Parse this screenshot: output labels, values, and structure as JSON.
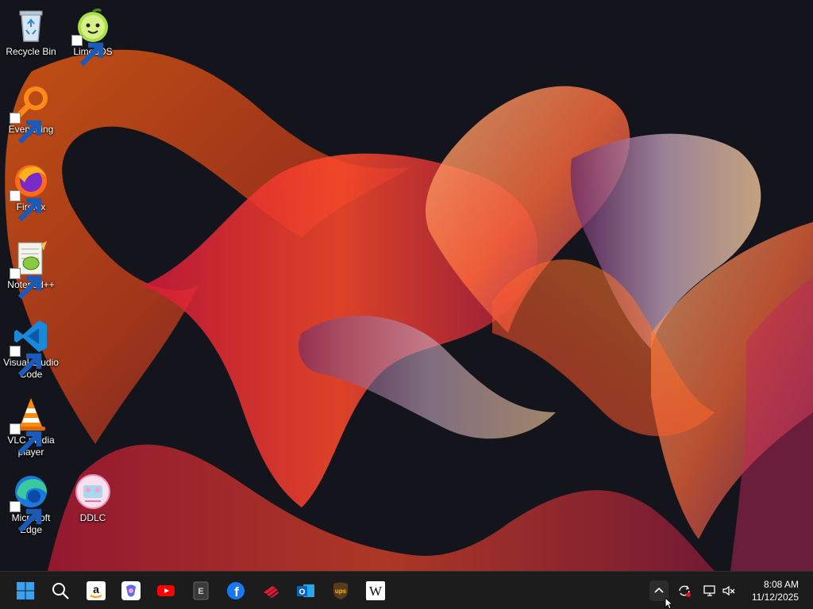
{
  "desktop": {
    "icons": [
      {
        "label": "Recycle Bin",
        "icon": "recycle-bin-icon"
      },
      {
        "label": "Lime3DS",
        "icon": "lime3ds-icon"
      },
      {
        "label": "Everything",
        "icon": "everything-search-icon"
      },
      {
        "label": "Firefox",
        "icon": "firefox-icon"
      },
      {
        "label": "Notepad++",
        "icon": "notepad-plus-plus-icon"
      },
      {
        "label": "Visual Studio Code",
        "icon": "vscode-icon"
      },
      {
        "label": "VLC media player",
        "icon": "vlc-icon"
      },
      {
        "label": "Microsoft Edge",
        "icon": "edge-icon"
      },
      {
        "label": "DDLC",
        "icon": "ddlc-icon"
      }
    ]
  },
  "taskbar": {
    "pinned": [
      {
        "icon": "start-icon"
      },
      {
        "icon": "search-icon"
      },
      {
        "icon": "amazon-icon",
        "text": "a"
      },
      {
        "icon": "copilot-icon"
      },
      {
        "icon": "youtube-icon"
      },
      {
        "icon": "epic-games-icon",
        "text": "E"
      },
      {
        "icon": "facebook-icon",
        "text": "f"
      },
      {
        "icon": "bank-of-america-icon"
      },
      {
        "icon": "outlook-icon",
        "text": "O"
      },
      {
        "icon": "ups-icon",
        "text": "ups"
      },
      {
        "icon": "wikipedia-icon",
        "text": "W"
      }
    ],
    "tray": [
      {
        "icon": "chevron-up-icon"
      },
      {
        "icon": "sync-icon"
      },
      {
        "icon": "network-icon"
      },
      {
        "icon": "volume-muted-icon"
      }
    ],
    "clock": {
      "time": "8:08 AM",
      "date": "11/12/2025"
    }
  },
  "colors": {
    "taskbar": "#1c1c1c",
    "accent": "#0078d4",
    "wallpaper_bg": "#14151c"
  }
}
